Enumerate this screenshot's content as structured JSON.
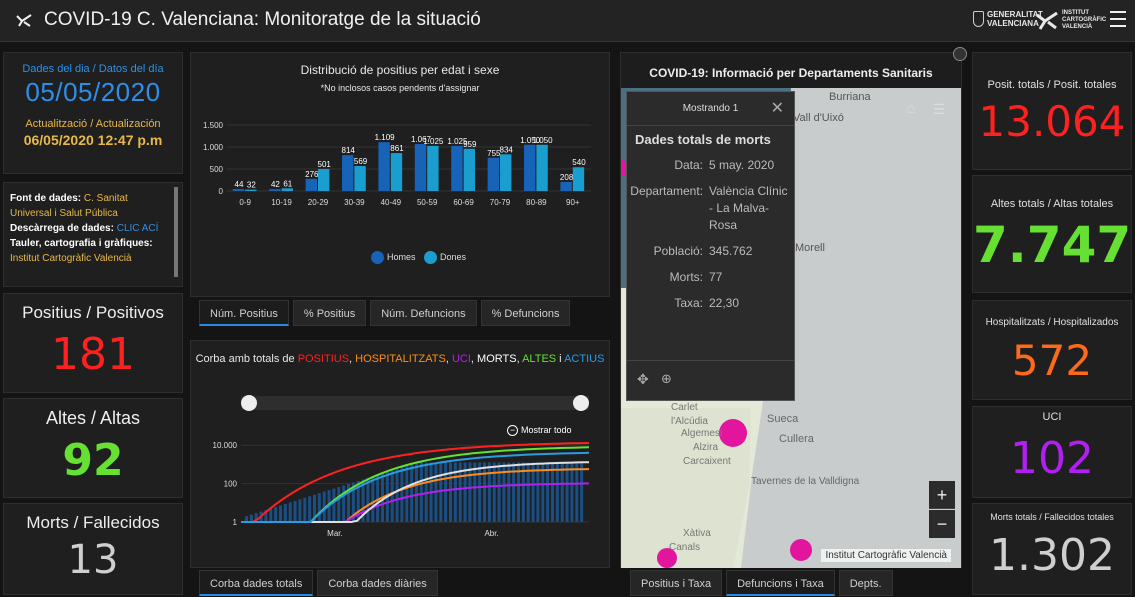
{
  "header": {
    "title": "COVID-19 C. Valenciana: Monitoratge de la situació",
    "gva_line1": "GENERALITAT",
    "gva_line2": "VALENCIANA",
    "icv_line1": "INSTITUT",
    "icv_line2": "CARTOGRÀFIC",
    "icv_line3": "VALENCIÀ"
  },
  "left": {
    "date_label": "Dades del dia / Datos del día",
    "date_value": "05/05/2020",
    "update_label": "Actualització / Actualización",
    "update_value": "06/05/2020 12:47 p.m",
    "source_label": "Font de dades:",
    "source_value_1": " C. Sanitat",
    "source_value_2": "Universal i Salut Pública",
    "download_label": "Descàrrega de dades:",
    "download_link": " CLIC ACÍ",
    "board_label": "Tauler, cartografia i gràfiques:",
    "board_value": "Institut Cartogràfic Valencià",
    "positius_label": "Positius / Positivos",
    "positius_value": "181",
    "altes_label": "Altes / Altas",
    "altes_value": "92",
    "morts_label": "Morts / Fallecidos",
    "morts_value": "13"
  },
  "right": {
    "posit_label": "Posit. totals / Posit. totales",
    "posit_value": "13.064",
    "altes_label": "Altes totals / Altas totales",
    "altes_value": "7.747",
    "hosp_label": "Hospitalitzats / Hospitalizados",
    "hosp_value": "572",
    "uci_label": "UCI",
    "uci_value": "102",
    "morts_label": "Morts totals / Fallecidos totales",
    "morts_value": "1.302"
  },
  "age_chart": {
    "title": "Distribució de positius per edat i sexe",
    "subtitle": "*No inclosos casos pendents d'assignar",
    "legend_men": "Homes",
    "legend_women": "Dones",
    "tabs": [
      "Núm. Positius",
      "% Positius",
      "Núm. Defuncions",
      "% Defuncions"
    ]
  },
  "curve_chart": {
    "title_prefix": "Corba amb totals de ",
    "t_positius": "POSITIUS",
    "t_hosp": "HOSPITALITZATS",
    "t_uci": "UCI",
    "t_morts": "MORTS",
    "t_altes": "ALTES",
    "t_i": " i ",
    "t_actius": "ACTIUS",
    "zoom_label": "Mostrar todo",
    "tabs": [
      "Corba dades totals",
      "Corba dades diàries"
    ]
  },
  "map": {
    "title": "COVID-19: Informació per Departaments Sanitaris",
    "attribution": "Institut Cartogràfic Valencià",
    "labels": [
      "Burriana",
      "Vall d'Uixó",
      "Carlet",
      "l'Alcúdia",
      "Sueca",
      "Cullera",
      "Algemesí",
      "Alzira",
      "Carcaixent",
      "Tavernes de la Valldigna",
      "Xàtiva",
      "Canals",
      "Morell"
    ],
    "tabs": [
      "Positius i Taxa",
      "Defuncions i Taxa",
      "Depts."
    ],
    "popup": {
      "header": "Mostrando 1",
      "title": "Dades totals de morts",
      "rows": [
        {
          "k": "Data:",
          "v": "5 may. 2020"
        },
        {
          "k": "Departament:",
          "v": "València Clínic - La Malva-Rosa"
        },
        {
          "k": "Població:",
          "v": "345.762"
        },
        {
          "k": "Morts:",
          "v": "77"
        },
        {
          "k": "Taxa:",
          "v": "22,30"
        }
      ]
    }
  },
  "colors": {
    "date_blue": "#2f8fe8",
    "update_gold": "#e8b84a",
    "red": "#ff2020",
    "green": "#66e032",
    "orange": "#ff6a1a",
    "purple": "#b020f0",
    "men_blue": "#1763b8",
    "women_teal": "#1a9ed0"
  },
  "chart_data": [
    {
      "type": "bar",
      "title": "Distribució de positius per edat i sexe",
      "subtitle": "*No inclosos casos pendents d'assignar",
      "categories": [
        "0-9",
        "10-19",
        "20-29",
        "30-39",
        "40-49",
        "50-59",
        "60-69",
        "70-79",
        "80-89",
        "90+"
      ],
      "series": [
        {
          "name": "Homes",
          "values": [
            44,
            42,
            276,
            814,
            1109,
            1067,
            1025,
            755,
            1050,
            208
          ]
        },
        {
          "name": "Dones",
          "values": [
            32,
            61,
            501,
            569,
            861,
            1025,
            959,
            834,
            1050,
            540
          ]
        }
      ],
      "y_ticks": [
        "0",
        "500",
        "1.000",
        "1.500"
      ],
      "ylim": [
        0,
        1500
      ],
      "legend": "bottom"
    },
    {
      "type": "line",
      "title": "Corba amb totals de POSITIUS, HOSPITALITZATS, UCI, MORTS, ALTES i ACTIUS",
      "y_scale": "log",
      "y_ticks": [
        "1",
        "100",
        "10.000"
      ],
      "x_ticks": [
        "Mar.",
        "Abr."
      ],
      "series": [
        {
          "name": "POSITIUS",
          "color": "#ff2020",
          "start": 1,
          "end": 13064
        },
        {
          "name": "HOSPITALITZATS",
          "color": "#ff8c1a",
          "start": 1,
          "end": 572
        },
        {
          "name": "UCI",
          "color": "#b020f0",
          "start": 1,
          "end": 102
        },
        {
          "name": "MORTS",
          "color": "#e0e0e0",
          "start": 1,
          "end": 1302
        },
        {
          "name": "ALTES",
          "color": "#66e032",
          "start": 1,
          "end": 7747
        },
        {
          "name": "ACTIUS",
          "color": "#2a9ce0",
          "start": 1,
          "end": 4000
        }
      ]
    }
  ]
}
